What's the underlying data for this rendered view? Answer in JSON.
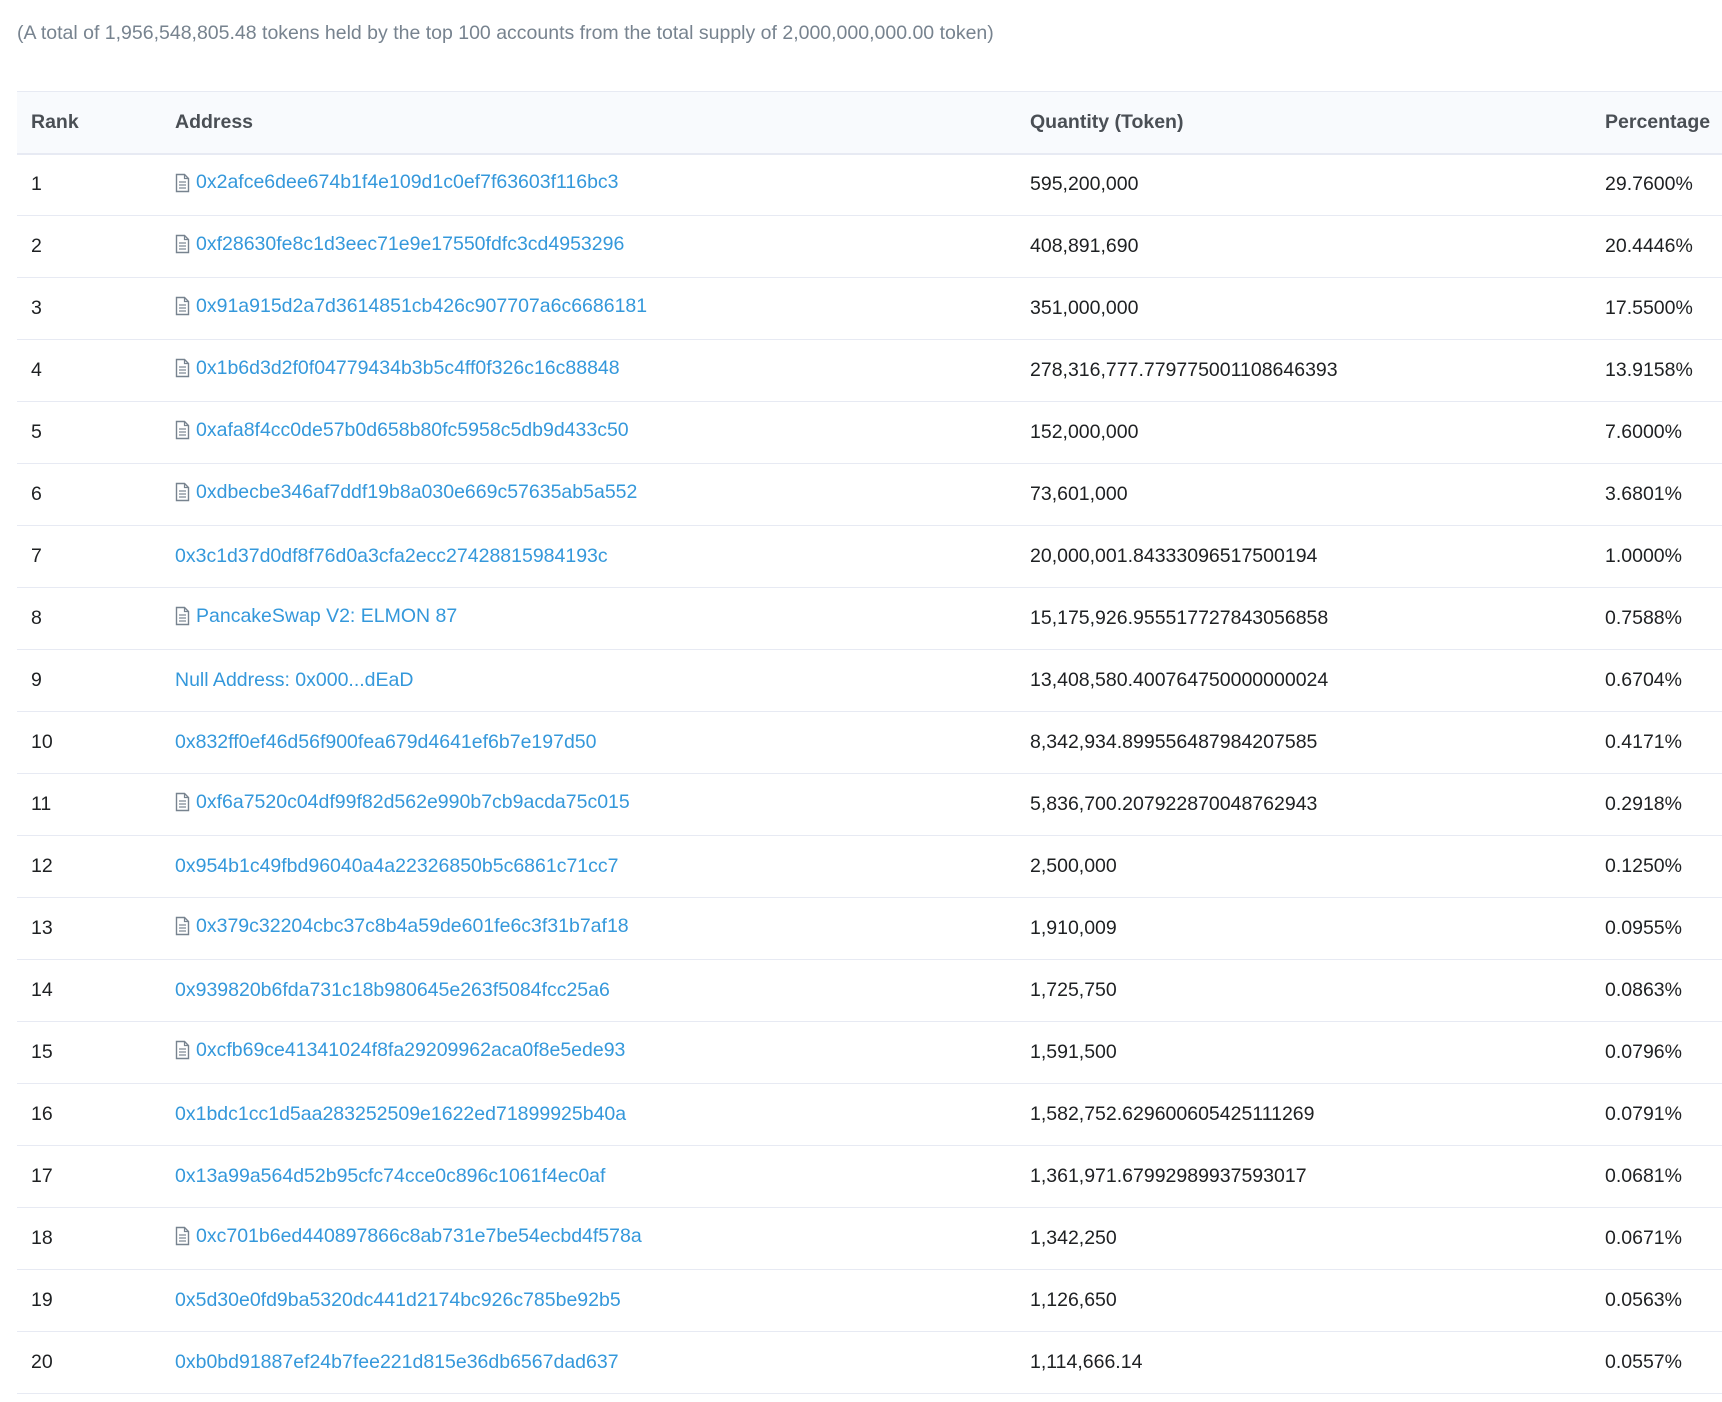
{
  "summary": "(A total of 1,956,548,805.48 tokens held by the top 100 accounts from the total supply of 2,000,000,000.00 token)",
  "table": {
    "headers": {
      "rank": "Rank",
      "address": "Address",
      "quantity": "Quantity (Token)",
      "percentage": "Percentage"
    },
    "rows": [
      {
        "rank": "1",
        "address": "0x2afce6dee674b1f4e109d1c0ef7f63603f116bc3",
        "contract": true,
        "quantity": "595,200,000",
        "percentage": "29.7600%"
      },
      {
        "rank": "2",
        "address": "0xf28630fe8c1d3eec71e9e17550fdfc3cd4953296",
        "contract": true,
        "quantity": "408,891,690",
        "percentage": "20.4446%"
      },
      {
        "rank": "3",
        "address": "0x91a915d2a7d3614851cb426c907707a6c6686181",
        "contract": true,
        "quantity": "351,000,000",
        "percentage": "17.5500%"
      },
      {
        "rank": "4",
        "address": "0x1b6d3d2f0f04779434b3b5c4ff0f326c16c88848",
        "contract": true,
        "quantity": "278,316,777.779775001108646393",
        "percentage": "13.9158%"
      },
      {
        "rank": "5",
        "address": "0xafa8f4cc0de57b0d658b80fc5958c5db9d433c50",
        "contract": true,
        "quantity": "152,000,000",
        "percentage": "7.6000%"
      },
      {
        "rank": "6",
        "address": "0xdbecbe346af7ddf19b8a030e669c57635ab5a552",
        "contract": true,
        "quantity": "73,601,000",
        "percentage": "3.6801%"
      },
      {
        "rank": "7",
        "address": "0x3c1d37d0df8f76d0a3cfa2ecc27428815984193c",
        "contract": false,
        "quantity": "20,000,001.84333096517500194",
        "percentage": "1.0000%"
      },
      {
        "rank": "8",
        "address": "PancakeSwap V2: ELMON 87",
        "contract": true,
        "quantity": "15,175,926.955517727843056858",
        "percentage": "0.7588%"
      },
      {
        "rank": "9",
        "address": "Null Address: 0x000...dEaD",
        "contract": false,
        "quantity": "13,408,580.400764750000000024",
        "percentage": "0.6704%"
      },
      {
        "rank": "10",
        "address": "0x832ff0ef46d56f900fea679d4641ef6b7e197d50",
        "contract": false,
        "quantity": "8,342,934.899556487984207585",
        "percentage": "0.4171%"
      },
      {
        "rank": "11",
        "address": "0xf6a7520c04df99f82d562e990b7cb9acda75c015",
        "contract": true,
        "quantity": "5,836,700.207922870048762943",
        "percentage": "0.2918%"
      },
      {
        "rank": "12",
        "address": "0x954b1c49fbd96040a4a22326850b5c6861c71cc7",
        "contract": false,
        "quantity": "2,500,000",
        "percentage": "0.1250%"
      },
      {
        "rank": "13",
        "address": "0x379c32204cbc37c8b4a59de601fe6c3f31b7af18",
        "contract": true,
        "quantity": "1,910,009",
        "percentage": "0.0955%"
      },
      {
        "rank": "14",
        "address": "0x939820b6fda731c18b980645e263f5084fcc25a6",
        "contract": false,
        "quantity": "1,725,750",
        "percentage": "0.0863%"
      },
      {
        "rank": "15",
        "address": "0xcfb69ce41341024f8fa29209962aca0f8e5ede93",
        "contract": true,
        "quantity": "1,591,500",
        "percentage": "0.0796%"
      },
      {
        "rank": "16",
        "address": "0x1bdc1cc1d5aa283252509e1622ed71899925b40a",
        "contract": false,
        "quantity": "1,582,752.629600605425111269",
        "percentage": "0.0791%"
      },
      {
        "rank": "17",
        "address": "0x13a99a564d52b95cfc74cce0c896c1061f4ec0af",
        "contract": false,
        "quantity": "1,361,971.67992989937593017",
        "percentage": "0.0681%"
      },
      {
        "rank": "18",
        "address": "0xc701b6ed440897866c8ab731e7be54ecbd4f578a",
        "contract": true,
        "quantity": "1,342,250",
        "percentage": "0.0671%"
      },
      {
        "rank": "19",
        "address": "0x5d30e0fd9ba5320dc441d2174bc926c785be92b5",
        "contract": false,
        "quantity": "1,126,650",
        "percentage": "0.0563%"
      },
      {
        "rank": "20",
        "address": "0xb0bd91887ef24b7fee221d815e36db6567dad637",
        "contract": false,
        "quantity": "1,114,666.14",
        "percentage": "0.0557%"
      }
    ]
  },
  "colors": {
    "link": "#3498db",
    "muted_text": "#77838f",
    "header_bg": "#f8fafd",
    "border": "#e7eaf3"
  },
  "icons": {
    "contract": "document-icon"
  }
}
